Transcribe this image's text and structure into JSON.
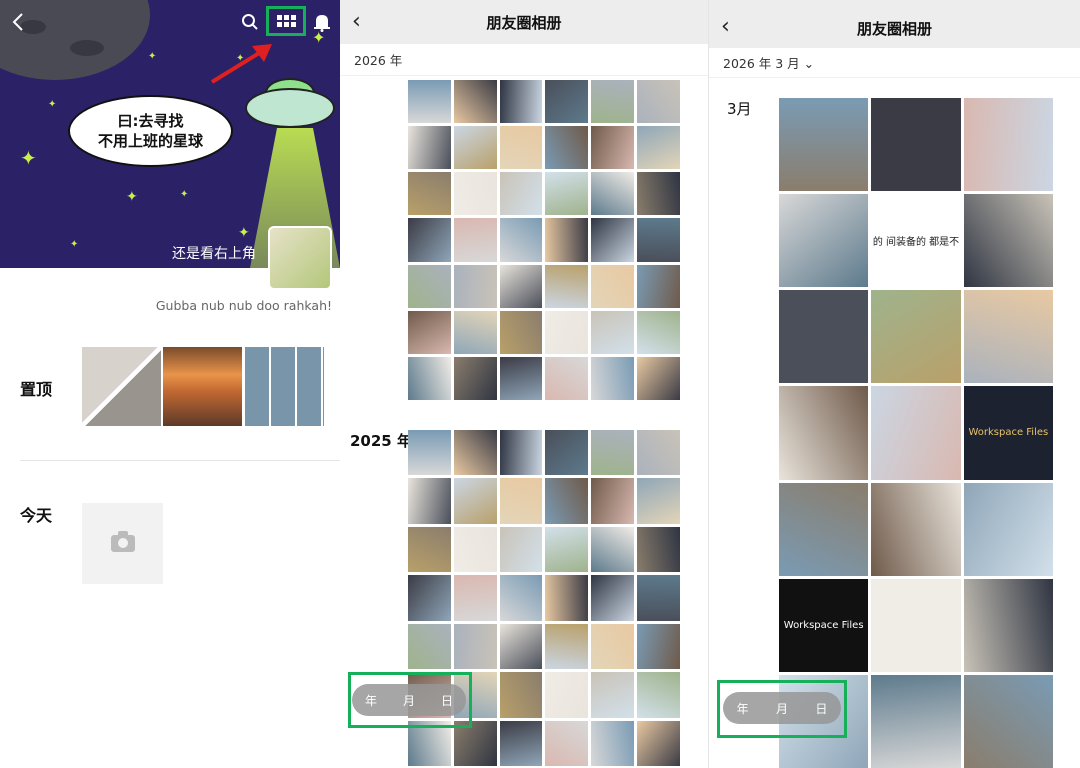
{
  "colors": {
    "accent_green": "#17b05a",
    "nav_bg": "#ededed",
    "cover_bg": "#2a2166"
  },
  "profile": {
    "bubble_line1": "曰:去寻找",
    "bubble_line2": "不用上班的星球",
    "cover_caption": "还是看右上角",
    "signature": "Gubba nub nub doo rahkah!",
    "pinned_label": "置顶",
    "today_label": "今天",
    "icons": [
      "back-icon",
      "search-icon",
      "grid-icon",
      "bell-icon",
      "camera-icon"
    ]
  },
  "album_year": {
    "title": "朋友圈相册",
    "header": "2026 年",
    "year_2025": "2025 年",
    "toggle": {
      "year": "年",
      "month": "月",
      "day": "日"
    }
  },
  "album_month": {
    "title": "朋友圈相册",
    "header": "2026 年 3 月 ⌄",
    "month_label": "3月",
    "cell_texts": [
      "的 间装备的 都是不",
      "Workspace Files",
      "Workspace Files"
    ],
    "toggle": {
      "year": "年",
      "month": "月",
      "day": "日"
    }
  }
}
